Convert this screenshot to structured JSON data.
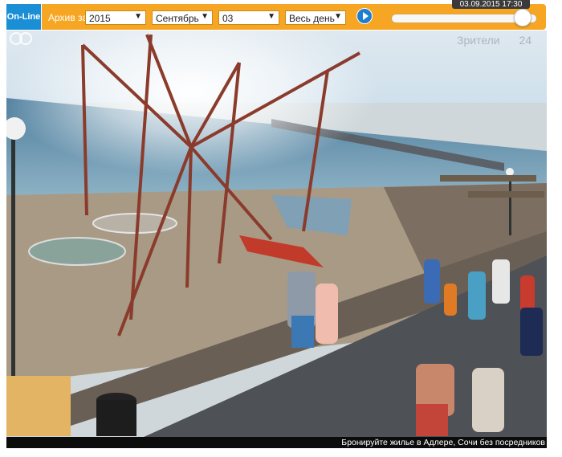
{
  "topbar": {
    "online_label": "On-Line",
    "archive_label": "Архив за",
    "year": "2015",
    "month": "Сентябрь",
    "day": "03",
    "period": "Весь день",
    "timestamp": "03.09.2015 17:30",
    "timeline_position": 0.9
  },
  "view": {
    "viewers_label": "Зрители",
    "viewers_count": "24",
    "ad_text": "Бронируйте жилье в Адлере, Сочи без посредников"
  },
  "colors": {
    "online_bg": "#1b8fd6",
    "panel_bg": "#f6a623",
    "play_button": "#1e7fd0"
  },
  "icons": {
    "play": "play-icon",
    "dropdown": "chevron-down-icon",
    "watermark": "camera-logo-icon"
  }
}
